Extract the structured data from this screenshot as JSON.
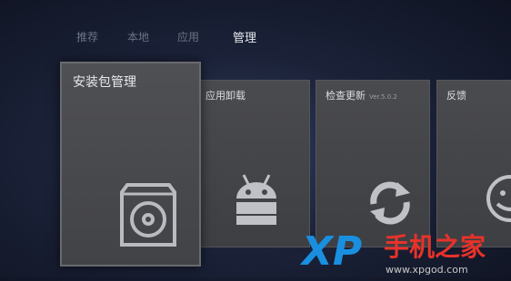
{
  "tabs": [
    "推荐",
    "本地",
    "应用",
    "管理"
  ],
  "active_tab": "管理",
  "tiles": [
    {
      "label": "安装包管理",
      "icon": "package-icon"
    },
    {
      "label": "应用卸载",
      "icon": "android-icon"
    },
    {
      "label": "检查更新",
      "sub": "Ver.5.0.2",
      "icon": "refresh-icon"
    },
    {
      "label": "反馈",
      "icon": "smiley-icon"
    }
  ],
  "watermark": {
    "xp": "XP",
    "brand": "手机之家",
    "url": "www.xpgod.com"
  },
  "colors": {
    "tile": "#46474b",
    "logo_blue": "#1a8fe0",
    "logo_red": "#e8322a"
  }
}
